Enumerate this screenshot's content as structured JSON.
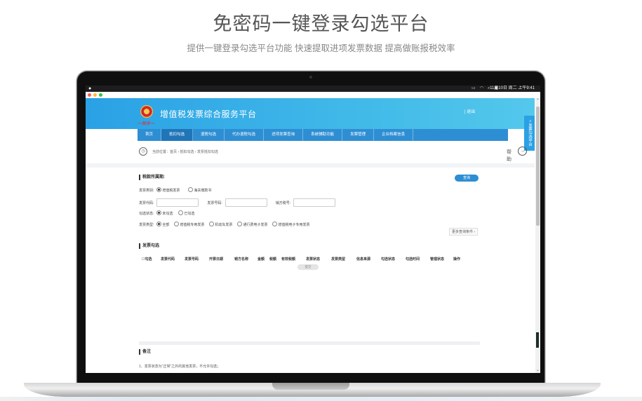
{
  "hero": {
    "title": "免密码一键登录勾选平台",
    "subtitle": "提供一键登录勾选平台功能 快速提取进项发票数据 提高做账报税效率"
  },
  "mac": {
    "clock": "11月10日 周二 上午9:41"
  },
  "app": {
    "site_title": "增值税发票综合服务平台",
    "logout": "| 退出",
    "side_tab": "< 发票勾选平台",
    "nav": [
      {
        "label": "首页"
      },
      {
        "label": "抵扣勾选"
      },
      {
        "label": "退税勾选"
      },
      {
        "label": "代办退税勾选"
      },
      {
        "label": "进项发票查询"
      },
      {
        "label": "系统辅助功能"
      },
      {
        "label": "发票管理"
      },
      {
        "label": "企业档案信息"
      }
    ],
    "breadcrumb": "当前位置：首页 › 抵扣勾选 › 发票抵扣勾选",
    "help": "帮助",
    "tax_period": {
      "heading": "税款所属期:",
      "query_button": "查询",
      "invoice_kind_label": "发票类别:",
      "invoice_kind_options": [
        "增值税发票",
        "海关缴款书"
      ],
      "code_label": "发票代码:",
      "number_label": "发票号码:",
      "seller_tax_label": "销方税号:",
      "check_status_label": "勾选状态:",
      "check_status_options": [
        "未勾选",
        "已勾选"
      ],
      "invoice_type_label": "发票类型:",
      "invoice_type_options": [
        "全部",
        "增值税专用发票",
        "机动车发票",
        "通行费电子发票",
        "增值税电子专用发票"
      ],
      "more_button": "更多查询条件 ›"
    },
    "invoice_check": {
      "heading": "发票勾选",
      "columns": [
        "☐勾选",
        "发票代码",
        "发票号码",
        "开票日期",
        "销方名称",
        "金额",
        "税额",
        "有效税额",
        "发票状态",
        "发票类型",
        "信息来源",
        "勾选状态",
        "勾选时间",
        "管理状态",
        "操作"
      ],
      "submit_button": "提交"
    },
    "notes": {
      "heading": "备注",
      "line1": "1、发票状态为“正常”之外的其他发票，不允许勾选；"
    }
  },
  "colors": {
    "header_start": "#2aa1e5",
    "nav_bg": "#2e8ed3",
    "traffic_red": "#fe5f57",
    "traffic_yellow": "#febc2e",
    "traffic_green": "#28c840"
  }
}
